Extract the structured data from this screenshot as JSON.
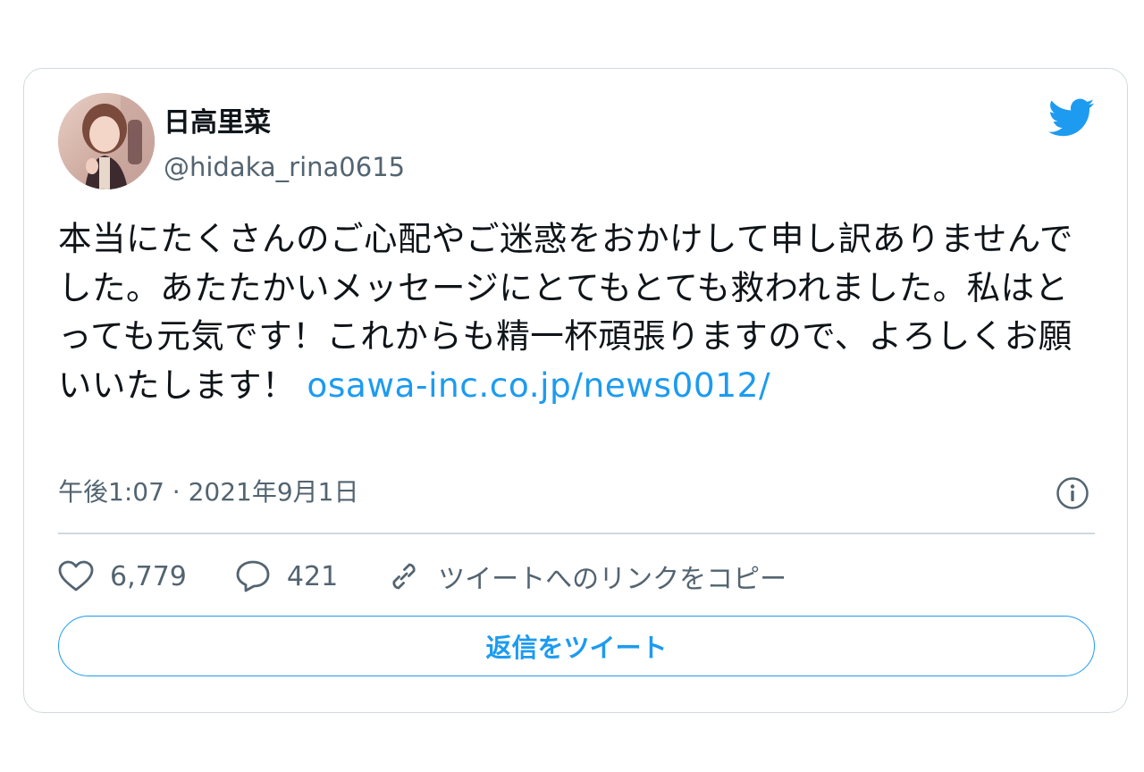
{
  "author": {
    "display_name": "日高里菜",
    "handle": "@hidaka_rina0615"
  },
  "icons": {
    "brand": "twitter-bird-icon",
    "info": "info-icon",
    "like": "heart-icon",
    "reply": "speech-bubble-icon",
    "copy_link": "link-icon"
  },
  "tweet": {
    "text": "本当にたくさんのご心配やご迷惑をおかけして申し訳ありませんでした。あたたかいメッセージにとてもとても救われました。私はとっても元気です！これからも精一杯頑張りますので、よろしくお願いいたします！",
    "link_text": "osawa-inc.co.jp/news0012/",
    "timestamp": "午後1:07 · 2021年9月1日"
  },
  "actions": {
    "likes": "6,779",
    "replies": "421",
    "copy_link_label": "ツイートへのリンクをコピー"
  },
  "reply_button_label": "返信をツイート",
  "colors": {
    "accent": "#1d9bf0",
    "text_primary": "#0f1419",
    "text_secondary": "#536471",
    "border": "#cfd9de"
  }
}
